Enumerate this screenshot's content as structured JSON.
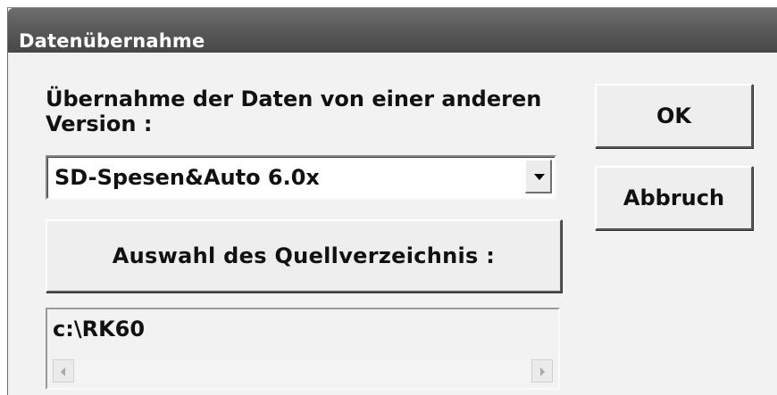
{
  "window": {
    "title": "Datenübernahme"
  },
  "prompt": {
    "text": "Übernahme der Daten von einer anderen\nVersion :"
  },
  "version_select": {
    "value": "SD-Spesen&Auto 6.0x"
  },
  "buttons": {
    "ok": "OK",
    "cancel": "Abbruch",
    "source": "Auswahl des Quellverzeichnis :"
  },
  "source_path": {
    "value": "c:\\RK60"
  },
  "icons": {
    "dropdown": "chevron-down-icon",
    "scroll_left": "arrow-left-icon",
    "scroll_right": "arrow-right-icon"
  }
}
